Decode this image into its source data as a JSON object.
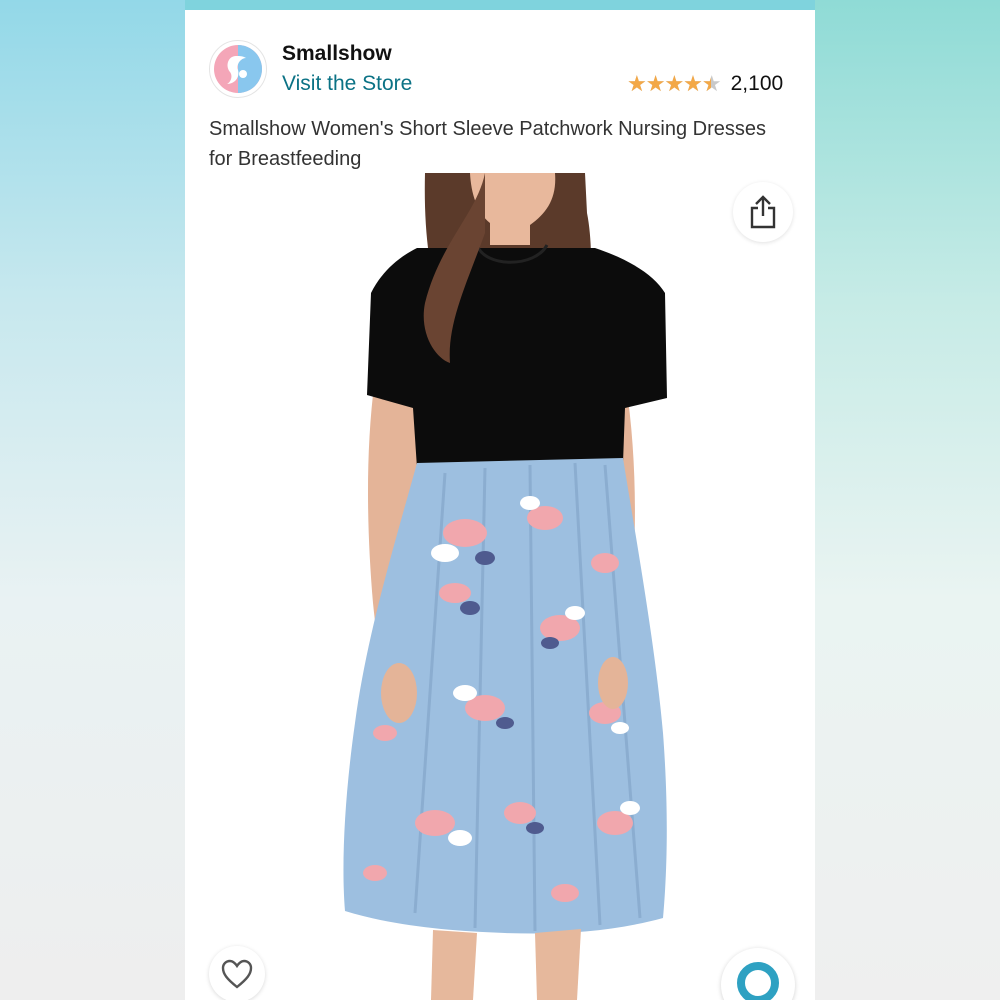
{
  "store": {
    "name": "Smallshow",
    "visit_label": "Visit the Store",
    "logo_icon": "smallshow-logo"
  },
  "rating": {
    "stars": 4.5,
    "count": "2,100",
    "star_color": "#f3a847"
  },
  "product": {
    "title": "Smallshow Women's Short Sleeve Patchwork Nursing Dresses for Breastfeeding"
  },
  "actions": {
    "share_icon": "share-icon",
    "favorite_icon": "heart-icon",
    "visual_search_icon": "lens-icon"
  },
  "colors": {
    "link": "#0b7285",
    "dress_top": "#0c0c0c",
    "dress_skirt": "#9dbfe0",
    "flower_pink": "#f1a7ad",
    "flower_navy": "#4f5b8f"
  }
}
